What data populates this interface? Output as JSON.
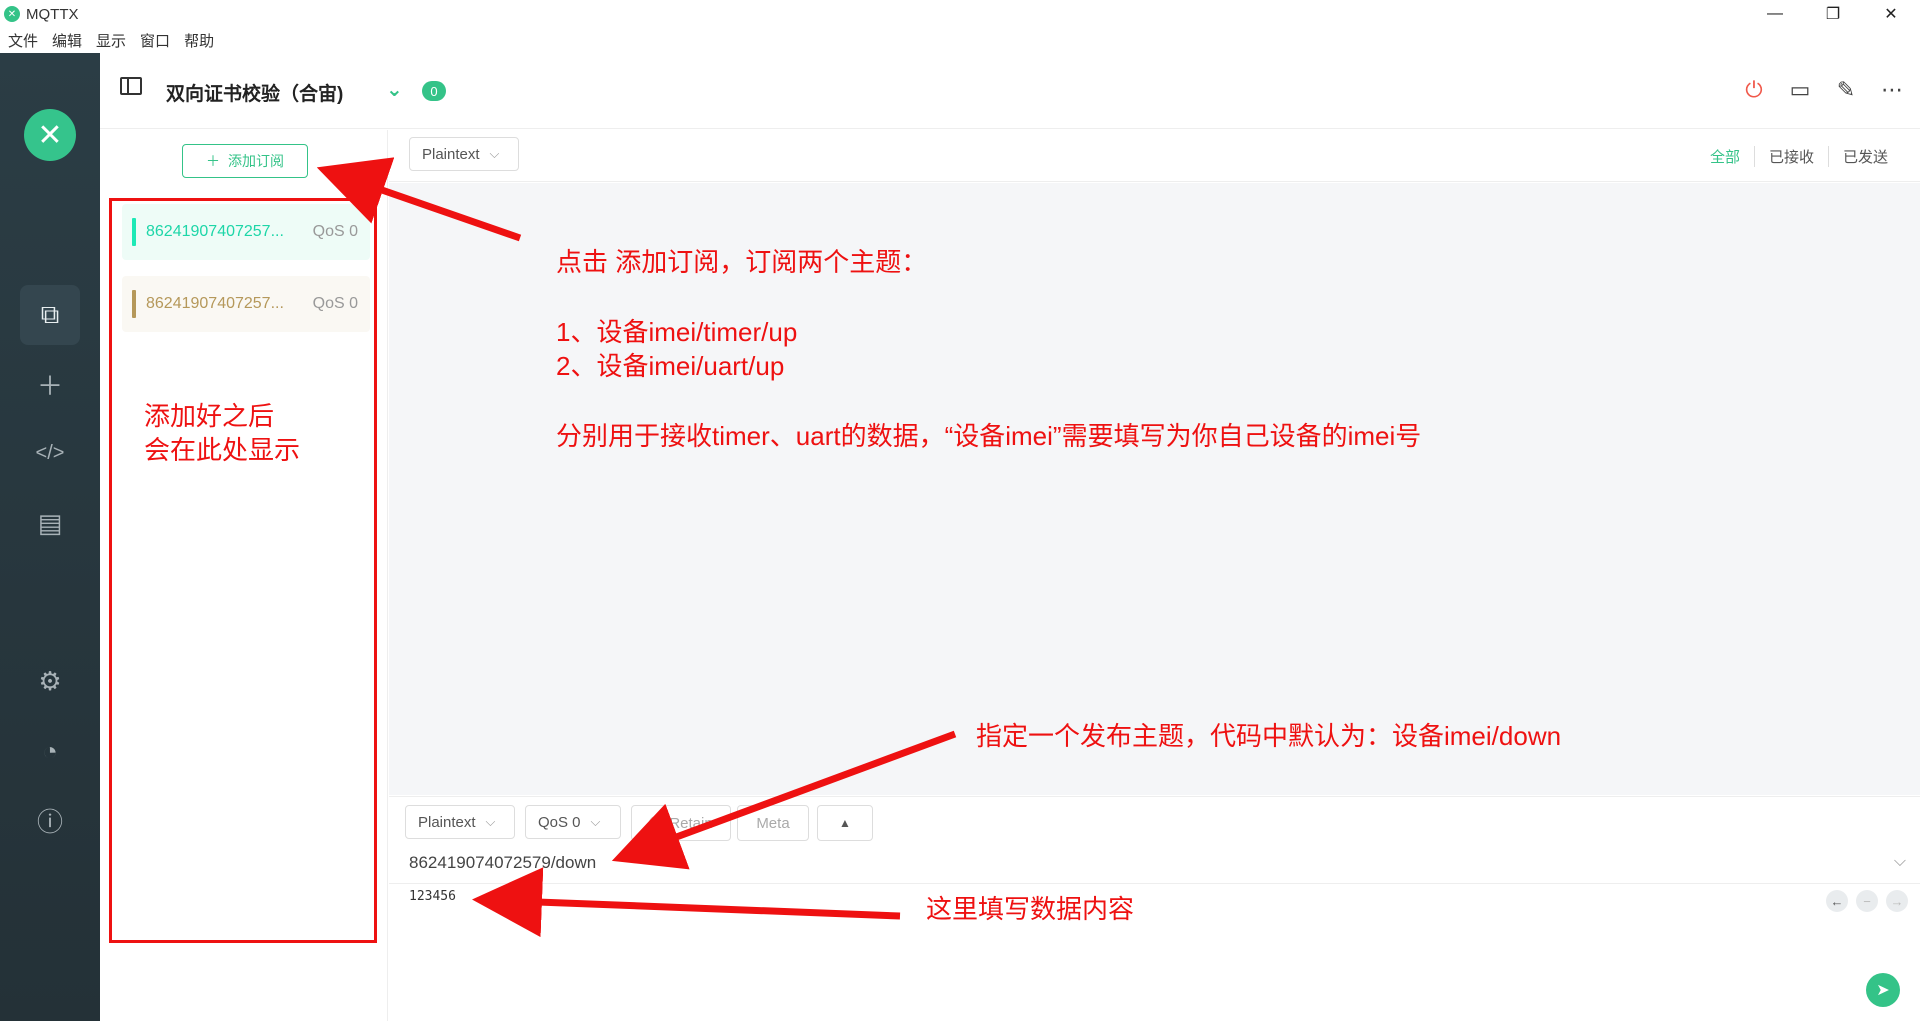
{
  "window": {
    "title": "MQTTX",
    "minimize": "—",
    "maximize": "❐",
    "close": "✕"
  },
  "menu": [
    "文件",
    "编辑",
    "显示",
    "窗口",
    "帮助"
  ],
  "header": {
    "connection_name": "双向证书校验（合宙)",
    "message_count": "0"
  },
  "subscriptions": {
    "add_label": "添加订阅",
    "items": [
      {
        "topic": "86241907407257...",
        "qos": "QoS 0",
        "color": "#1de9b6"
      },
      {
        "topic": "86241907407257...",
        "qos": "QoS 0",
        "color": "#b5985a"
      }
    ]
  },
  "messages": {
    "format": "Plaintext",
    "filters": [
      "全部",
      "已接收",
      "已发送"
    ]
  },
  "publish": {
    "format": "Plaintext",
    "qos": "QoS 0",
    "retain_label": "Retain",
    "meta_label": "Meta",
    "topic": "862419074072579/down",
    "payload": "123456"
  },
  "annotations": {
    "click_add": "点击 添加订阅，订阅两个主题：",
    "topic1": "1、设备imei/timer/up",
    "topic2": "2、设备imei/uart/up",
    "purpose": "分别用于接收timer、uart的数据，“设备imei”需要填写为你自己设备的imei号",
    "shown_here_1": "添加好之后",
    "shown_here_2": "会在此处显示",
    "publish_topic": "指定一个发布主题，代码中默认为：设备imei/down",
    "fill_payload": "这里填写数据内容"
  },
  "colors": {
    "accent": "#34c388",
    "annotation": "#ee1111",
    "sidebar": "#2b3d45"
  },
  "icons": [
    "mqttx-logo-icon",
    "connections-icon",
    "plus-icon",
    "script-icon",
    "log-icon",
    "settings-icon",
    "feed-icon",
    "info-icon",
    "sidebar-toggle-icon",
    "collapse-icon",
    "power-icon",
    "chat-icon",
    "edit-icon",
    "more-icon",
    "send-icon"
  ]
}
